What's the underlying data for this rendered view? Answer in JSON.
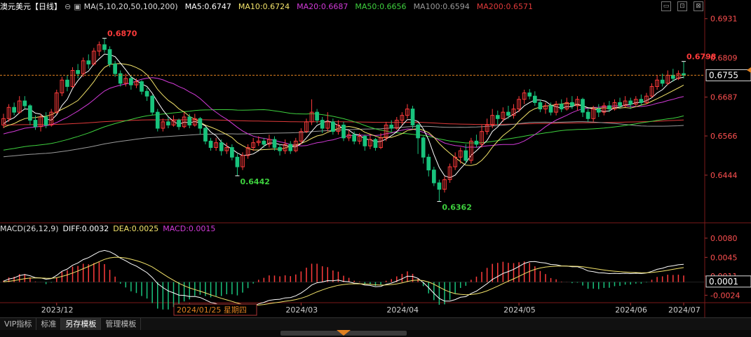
{
  "header": {
    "symbol": "澳元美元",
    "period": "【日线】",
    "ma_params": "MA(5,10,20,50,100,200)",
    "ma5": "MA5:0.6747",
    "ma10": "MA10:0.6724",
    "ma20": "MA20:0.6687",
    "ma50": "MA50:0.6656",
    "ma100": "MA100:0.6594",
    "ma200": "MA200:0.6571"
  },
  "macd_header": {
    "params": "MACD(26,12,9)",
    "diff": "DIFF:0.0032",
    "dea": "DEA:0.0025",
    "macd": "MACD:0.0015"
  },
  "price_axis": [
    "0.6931",
    "0.6809",
    "0.6687",
    "0.6566",
    "0.6444"
  ],
  "current_price": "0.6755",
  "macd_axis": [
    "0.0080",
    "0.0045",
    "0.0011",
    "-0.0024"
  ],
  "current_macd": "0.0001",
  "annotations": {
    "high1": "0.6870",
    "low1": "0.6442",
    "low2": "0.6362",
    "high2": "0.6798"
  },
  "date_axis": [
    "2023/12",
    "2024/01",
    "2024/03",
    "2024/04",
    "2024/05",
    "2024/06",
    "2024/07"
  ],
  "cursor_date": "2024/01/25 星期四",
  "tabs": [
    "VIP指标",
    "标准",
    "另存模板",
    "管理模板"
  ],
  "colors": {
    "up": "#ff3b3b",
    "down": "#19c37d",
    "ma5": "#ffffff",
    "ma10": "#f3e36a",
    "ma20": "#d23ad8",
    "ma50": "#3ed13e",
    "ma100": "#9a9a9a",
    "ma200": "#e03a3a",
    "price_label": "#ff3b3b",
    "low_label": "#3ed13e"
  },
  "chart_data": {
    "type": "candlestick",
    "title": "澳元美元【日线】",
    "ylim": [
      0.63,
      0.695
    ],
    "macd_ylim": [
      -0.0035,
      0.0085
    ],
    "candles": [
      {
        "o": 0.66,
        "c": 0.662,
        "h": 0.6635,
        "l": 0.659
      },
      {
        "o": 0.662,
        "c": 0.6655,
        "h": 0.6665,
        "l": 0.661
      },
      {
        "o": 0.6655,
        "c": 0.664,
        "h": 0.667,
        "l": 0.663
      },
      {
        "o": 0.664,
        "c": 0.6675,
        "h": 0.669,
        "l": 0.6635
      },
      {
        "o": 0.6675,
        "c": 0.666,
        "h": 0.669,
        "l": 0.665
      },
      {
        "o": 0.666,
        "c": 0.6615,
        "h": 0.6665,
        "l": 0.66
      },
      {
        "o": 0.6615,
        "c": 0.6595,
        "h": 0.663,
        "l": 0.6585
      },
      {
        "o": 0.6595,
        "c": 0.6625,
        "h": 0.6635,
        "l": 0.658
      },
      {
        "o": 0.6625,
        "c": 0.66,
        "h": 0.664,
        "l": 0.659
      },
      {
        "o": 0.66,
        "c": 0.664,
        "h": 0.665,
        "l": 0.6595
      },
      {
        "o": 0.664,
        "c": 0.67,
        "h": 0.671,
        "l": 0.6635
      },
      {
        "o": 0.67,
        "c": 0.674,
        "h": 0.675,
        "l": 0.669
      },
      {
        "o": 0.674,
        "c": 0.672,
        "h": 0.6755,
        "l": 0.6705
      },
      {
        "o": 0.672,
        "c": 0.677,
        "h": 0.678,
        "l": 0.6715
      },
      {
        "o": 0.677,
        "c": 0.676,
        "h": 0.679,
        "l": 0.6745
      },
      {
        "o": 0.676,
        "c": 0.68,
        "h": 0.681,
        "l": 0.675
      },
      {
        "o": 0.68,
        "c": 0.679,
        "h": 0.682,
        "l": 0.6775
      },
      {
        "o": 0.679,
        "c": 0.683,
        "h": 0.684,
        "l": 0.6785
      },
      {
        "o": 0.683,
        "c": 0.685,
        "h": 0.686,
        "l": 0.6815
      },
      {
        "o": 0.685,
        "c": 0.6835,
        "h": 0.687,
        "l": 0.6825
      },
      {
        "o": 0.6835,
        "c": 0.679,
        "h": 0.6845,
        "l": 0.678
      },
      {
        "o": 0.679,
        "c": 0.676,
        "h": 0.68,
        "l": 0.675
      },
      {
        "o": 0.676,
        "c": 0.673,
        "h": 0.677,
        "l": 0.672
      },
      {
        "o": 0.673,
        "c": 0.6745,
        "h": 0.676,
        "l": 0.672
      },
      {
        "o": 0.6745,
        "c": 0.6725,
        "h": 0.6755,
        "l": 0.671
      },
      {
        "o": 0.6725,
        "c": 0.6735,
        "h": 0.6745,
        "l": 0.6715
      },
      {
        "o": 0.6735,
        "c": 0.6705,
        "h": 0.674,
        "l": 0.6695
      },
      {
        "o": 0.6705,
        "c": 0.669,
        "h": 0.6715,
        "l": 0.6675
      },
      {
        "o": 0.669,
        "c": 0.664,
        "h": 0.6695,
        "l": 0.663
      },
      {
        "o": 0.664,
        "c": 0.659,
        "h": 0.665,
        "l": 0.658
      },
      {
        "o": 0.659,
        "c": 0.661,
        "h": 0.662,
        "l": 0.658
      },
      {
        "o": 0.661,
        "c": 0.66,
        "h": 0.6625,
        "l": 0.659
      },
      {
        "o": 0.66,
        "c": 0.6615,
        "h": 0.663,
        "l": 0.6595
      },
      {
        "o": 0.6615,
        "c": 0.6595,
        "h": 0.662,
        "l": 0.6585
      },
      {
        "o": 0.6595,
        "c": 0.6625,
        "h": 0.664,
        "l": 0.659
      },
      {
        "o": 0.6625,
        "c": 0.66,
        "h": 0.6635,
        "l": 0.659
      },
      {
        "o": 0.66,
        "c": 0.662,
        "h": 0.6635,
        "l": 0.6595
      },
      {
        "o": 0.662,
        "c": 0.659,
        "h": 0.6625,
        "l": 0.657
      },
      {
        "o": 0.659,
        "c": 0.655,
        "h": 0.6595,
        "l": 0.654
      },
      {
        "o": 0.655,
        "c": 0.653,
        "h": 0.656,
        "l": 0.652
      },
      {
        "o": 0.653,
        "c": 0.6545,
        "h": 0.656,
        "l": 0.652
      },
      {
        "o": 0.6545,
        "c": 0.652,
        "h": 0.6555,
        "l": 0.6505
      },
      {
        "o": 0.652,
        "c": 0.653,
        "h": 0.6545,
        "l": 0.651
      },
      {
        "o": 0.653,
        "c": 0.65,
        "h": 0.654,
        "l": 0.649
      },
      {
        "o": 0.65,
        "c": 0.647,
        "h": 0.651,
        "l": 0.6442
      },
      {
        "o": 0.647,
        "c": 0.6505,
        "h": 0.6515,
        "l": 0.646
      },
      {
        "o": 0.6505,
        "c": 0.653,
        "h": 0.654,
        "l": 0.6495
      },
      {
        "o": 0.653,
        "c": 0.6545,
        "h": 0.656,
        "l": 0.652
      },
      {
        "o": 0.6545,
        "c": 0.655,
        "h": 0.6565,
        "l": 0.6535
      },
      {
        "o": 0.655,
        "c": 0.654,
        "h": 0.656,
        "l": 0.653
      },
      {
        "o": 0.654,
        "c": 0.6555,
        "h": 0.657,
        "l": 0.653
      },
      {
        "o": 0.6555,
        "c": 0.653,
        "h": 0.6565,
        "l": 0.652
      },
      {
        "o": 0.653,
        "c": 0.652,
        "h": 0.654,
        "l": 0.6505
      },
      {
        "o": 0.652,
        "c": 0.654,
        "h": 0.6555,
        "l": 0.651
      },
      {
        "o": 0.654,
        "c": 0.652,
        "h": 0.655,
        "l": 0.651
      },
      {
        "o": 0.652,
        "c": 0.655,
        "h": 0.656,
        "l": 0.6515
      },
      {
        "o": 0.655,
        "c": 0.658,
        "h": 0.659,
        "l": 0.654
      },
      {
        "o": 0.658,
        "c": 0.661,
        "h": 0.662,
        "l": 0.6575
      },
      {
        "o": 0.661,
        "c": 0.664,
        "h": 0.668,
        "l": 0.66
      },
      {
        "o": 0.664,
        "c": 0.6615,
        "h": 0.665,
        "l": 0.6605
      },
      {
        "o": 0.6615,
        "c": 0.659,
        "h": 0.6625,
        "l": 0.6575
      },
      {
        "o": 0.659,
        "c": 0.661,
        "h": 0.664,
        "l": 0.658
      },
      {
        "o": 0.661,
        "c": 0.658,
        "h": 0.662,
        "l": 0.657
      },
      {
        "o": 0.658,
        "c": 0.66,
        "h": 0.6615,
        "l": 0.657
      },
      {
        "o": 0.66,
        "c": 0.656,
        "h": 0.661,
        "l": 0.655
      },
      {
        "o": 0.656,
        "c": 0.657,
        "h": 0.6585,
        "l": 0.655
      },
      {
        "o": 0.657,
        "c": 0.655,
        "h": 0.658,
        "l": 0.654
      },
      {
        "o": 0.655,
        "c": 0.6565,
        "h": 0.6575,
        "l": 0.654
      },
      {
        "o": 0.6565,
        "c": 0.6535,
        "h": 0.657,
        "l": 0.652
      },
      {
        "o": 0.6535,
        "c": 0.6555,
        "h": 0.657,
        "l": 0.6525
      },
      {
        "o": 0.6555,
        "c": 0.653,
        "h": 0.656,
        "l": 0.652
      },
      {
        "o": 0.653,
        "c": 0.656,
        "h": 0.6575,
        "l": 0.6525
      },
      {
        "o": 0.656,
        "c": 0.66,
        "h": 0.661,
        "l": 0.655
      },
      {
        "o": 0.66,
        "c": 0.659,
        "h": 0.6615,
        "l": 0.658
      },
      {
        "o": 0.659,
        "c": 0.6615,
        "h": 0.6625,
        "l": 0.6585
      },
      {
        "o": 0.6615,
        "c": 0.663,
        "h": 0.664,
        "l": 0.66
      },
      {
        "o": 0.663,
        "c": 0.665,
        "h": 0.6665,
        "l": 0.662
      },
      {
        "o": 0.665,
        "c": 0.66,
        "h": 0.666,
        "l": 0.659
      },
      {
        "o": 0.66,
        "c": 0.656,
        "h": 0.6605,
        "l": 0.651
      },
      {
        "o": 0.656,
        "c": 0.65,
        "h": 0.6565,
        "l": 0.648
      },
      {
        "o": 0.65,
        "c": 0.646,
        "h": 0.651,
        "l": 0.644
      },
      {
        "o": 0.646,
        "c": 0.642,
        "h": 0.647,
        "l": 0.641
      },
      {
        "o": 0.642,
        "c": 0.64,
        "h": 0.643,
        "l": 0.6362
      },
      {
        "o": 0.64,
        "c": 0.643,
        "h": 0.644,
        "l": 0.639
      },
      {
        "o": 0.643,
        "c": 0.647,
        "h": 0.648,
        "l": 0.642
      },
      {
        "o": 0.647,
        "c": 0.65,
        "h": 0.6515,
        "l": 0.646
      },
      {
        "o": 0.65,
        "c": 0.652,
        "h": 0.653,
        "l": 0.648
      },
      {
        "o": 0.652,
        "c": 0.649,
        "h": 0.654,
        "l": 0.648
      },
      {
        "o": 0.649,
        "c": 0.655,
        "h": 0.656,
        "l": 0.648
      },
      {
        "o": 0.655,
        "c": 0.654,
        "h": 0.657,
        "l": 0.653
      },
      {
        "o": 0.654,
        "c": 0.658,
        "h": 0.66,
        "l": 0.653
      },
      {
        "o": 0.658,
        "c": 0.66,
        "h": 0.662,
        "l": 0.657
      },
      {
        "o": 0.66,
        "c": 0.663,
        "h": 0.665,
        "l": 0.659
      },
      {
        "o": 0.663,
        "c": 0.662,
        "h": 0.6645,
        "l": 0.66
      },
      {
        "o": 0.662,
        "c": 0.664,
        "h": 0.6655,
        "l": 0.661
      },
      {
        "o": 0.664,
        "c": 0.663,
        "h": 0.666,
        "l": 0.662
      },
      {
        "o": 0.663,
        "c": 0.665,
        "h": 0.6665,
        "l": 0.662
      },
      {
        "o": 0.665,
        "c": 0.668,
        "h": 0.669,
        "l": 0.664
      },
      {
        "o": 0.668,
        "c": 0.67,
        "h": 0.671,
        "l": 0.6665
      },
      {
        "o": 0.67,
        "c": 0.669,
        "h": 0.6712,
        "l": 0.668
      },
      {
        "o": 0.669,
        "c": 0.667,
        "h": 0.6705,
        "l": 0.666
      },
      {
        "o": 0.667,
        "c": 0.665,
        "h": 0.668,
        "l": 0.664
      },
      {
        "o": 0.665,
        "c": 0.666,
        "h": 0.667,
        "l": 0.6635
      },
      {
        "o": 0.666,
        "c": 0.664,
        "h": 0.667,
        "l": 0.663
      },
      {
        "o": 0.664,
        "c": 0.6665,
        "h": 0.6675,
        "l": 0.663
      },
      {
        "o": 0.6665,
        "c": 0.665,
        "h": 0.668,
        "l": 0.664
      },
      {
        "o": 0.665,
        "c": 0.667,
        "h": 0.6685,
        "l": 0.6645
      },
      {
        "o": 0.667,
        "c": 0.666,
        "h": 0.669,
        "l": 0.665
      },
      {
        "o": 0.666,
        "c": 0.668,
        "h": 0.669,
        "l": 0.6645
      },
      {
        "o": 0.668,
        "c": 0.664,
        "h": 0.6685,
        "l": 0.6625
      },
      {
        "o": 0.664,
        "c": 0.662,
        "h": 0.665,
        "l": 0.661
      },
      {
        "o": 0.662,
        "c": 0.665,
        "h": 0.666,
        "l": 0.661
      },
      {
        "o": 0.665,
        "c": 0.664,
        "h": 0.6665,
        "l": 0.6625
      },
      {
        "o": 0.664,
        "c": 0.666,
        "h": 0.667,
        "l": 0.663
      },
      {
        "o": 0.666,
        "c": 0.665,
        "h": 0.6675,
        "l": 0.664
      },
      {
        "o": 0.665,
        "c": 0.667,
        "h": 0.668,
        "l": 0.6645
      },
      {
        "o": 0.667,
        "c": 0.666,
        "h": 0.6685,
        "l": 0.665
      },
      {
        "o": 0.666,
        "c": 0.6675,
        "h": 0.669,
        "l": 0.6655
      },
      {
        "o": 0.6675,
        "c": 0.6665,
        "h": 0.6685,
        "l": 0.665
      },
      {
        "o": 0.6665,
        "c": 0.668,
        "h": 0.669,
        "l": 0.666
      },
      {
        "o": 0.668,
        "c": 0.667,
        "h": 0.6695,
        "l": 0.666
      },
      {
        "o": 0.667,
        "c": 0.669,
        "h": 0.67,
        "l": 0.6665
      },
      {
        "o": 0.669,
        "c": 0.672,
        "h": 0.673,
        "l": 0.6685
      },
      {
        "o": 0.672,
        "c": 0.674,
        "h": 0.6755,
        "l": 0.671
      },
      {
        "o": 0.674,
        "c": 0.673,
        "h": 0.676,
        "l": 0.672
      },
      {
        "o": 0.673,
        "c": 0.6755,
        "h": 0.677,
        "l": 0.6725
      },
      {
        "o": 0.6755,
        "c": 0.6745,
        "h": 0.6775,
        "l": 0.6735
      },
      {
        "o": 0.6745,
        "c": 0.676,
        "h": 0.677,
        "l": 0.674
      },
      {
        "o": 0.676,
        "c": 0.6755,
        "h": 0.6798,
        "l": 0.6745
      }
    ]
  }
}
